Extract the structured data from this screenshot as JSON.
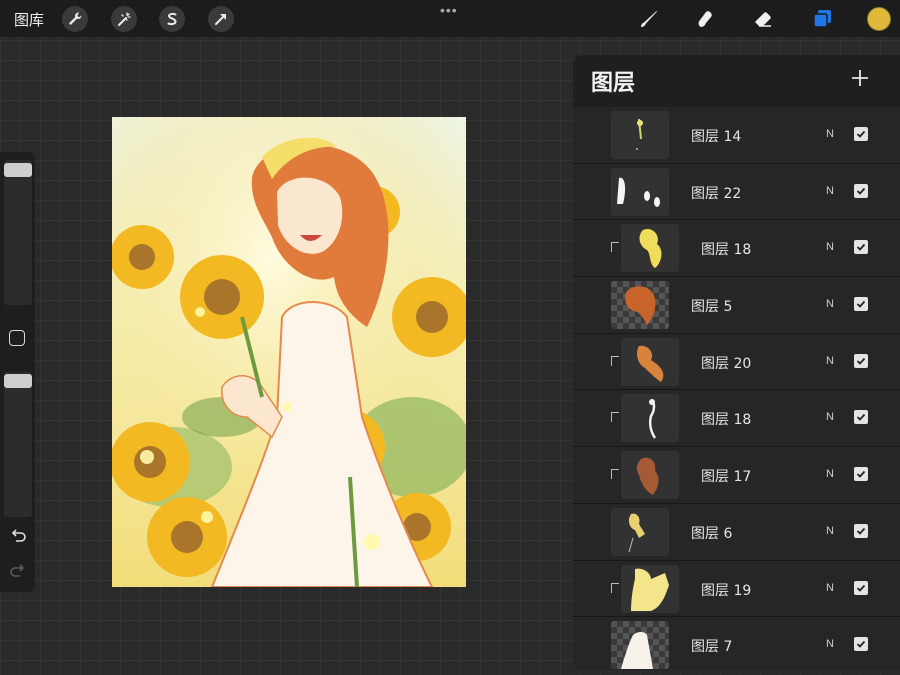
{
  "topbar": {
    "gallery_label": "图库",
    "left_tools": [
      "wrench-icon",
      "magic-wand-icon",
      "selection-s-icon",
      "arrow-transform-icon"
    ],
    "right_tools": [
      "brush-icon",
      "smudge-icon",
      "eraser-icon",
      "layers-icon"
    ],
    "current_color": "#e0b93a",
    "layers_tool_color": "#1f74e8"
  },
  "layers_panel": {
    "title": "图层",
    "layers": [
      {
        "name": "图层 14",
        "blend": "N",
        "visible": true,
        "clipped": false
      },
      {
        "name": "图层 22",
        "blend": "N",
        "visible": true,
        "clipped": false
      },
      {
        "name": "图层 18",
        "blend": "N",
        "visible": true,
        "clipped": true
      },
      {
        "name": "图层 5",
        "blend": "N",
        "visible": true,
        "clipped": false
      },
      {
        "name": "图层 20",
        "blend": "N",
        "visible": true,
        "clipped": true
      },
      {
        "name": "图层 18",
        "blend": "N",
        "visible": true,
        "clipped": true
      },
      {
        "name": "图层 17",
        "blend": "N",
        "visible": true,
        "clipped": true
      },
      {
        "name": "图层 6",
        "blend": "N",
        "visible": true,
        "clipped": false
      },
      {
        "name": "图层 19",
        "blend": "N",
        "visible": true,
        "clipped": true
      },
      {
        "name": "图层 7",
        "blend": "N",
        "visible": true,
        "clipped": false
      }
    ]
  },
  "sidebar": {
    "brush_size_level": 0.95,
    "opacity_level": 0.95
  }
}
